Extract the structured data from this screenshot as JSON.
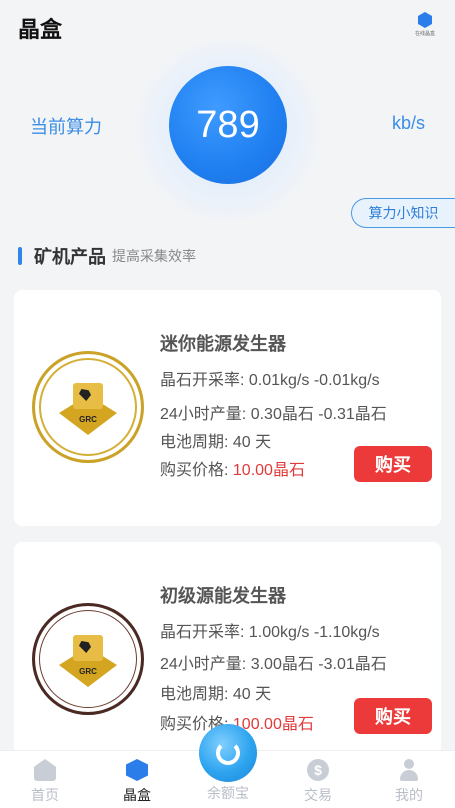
{
  "header": {
    "title": "晶盒",
    "logo_caption": "在线晶盒",
    "logo_icon": "crystal-box-logo"
  },
  "power": {
    "label": "当前算力",
    "value": "789",
    "unit": "kb/s",
    "knowledge_button": "算力小知识"
  },
  "section": {
    "title": "矿机产品",
    "subtitle": "提高采集效率"
  },
  "products": [
    {
      "name": "迷你能源发生器",
      "rate_label": "晶石开采率:",
      "rate_value": "0.01kg/s -0.01kg/s",
      "output_label": "24小时产量:",
      "output_value": "0.30晶石 -0.31晶石",
      "cycle_label": "电池周期:",
      "cycle_value": "40 天",
      "price_label": "购买价格:",
      "price_value": "10.00晶石",
      "buy_label": "购买",
      "coin_text": "GRC",
      "ring_color": "#c9a227"
    },
    {
      "name": "初级源能发生器",
      "rate_label": "晶石开采率:",
      "rate_value": "1.00kg/s -1.10kg/s",
      "output_label": "24小时产量:",
      "output_value": "3.00晶石 -3.01晶石",
      "cycle_label": "电池周期:",
      "cycle_value": "40 天",
      "price_label": "购买价格:",
      "price_value": "100.00晶石",
      "buy_label": "购买",
      "coin_text": "GRC",
      "ring_color": "#4a2a22"
    }
  ],
  "tabbar": {
    "items": [
      {
        "label": "首页",
        "icon": "home-icon",
        "active": false
      },
      {
        "label": "晶盒",
        "icon": "crystal-box-icon",
        "active": true
      },
      {
        "label": "余额宝",
        "icon": "balance-icon",
        "active": false
      },
      {
        "label": "交易",
        "icon": "trade-icon",
        "active": false
      },
      {
        "label": "我的",
        "icon": "profile-icon",
        "active": false
      }
    ],
    "money_symbol": "$"
  },
  "colors": {
    "accent": "#2f86e8",
    "buy": "#ec3a3a",
    "price": "#e03a3a"
  }
}
